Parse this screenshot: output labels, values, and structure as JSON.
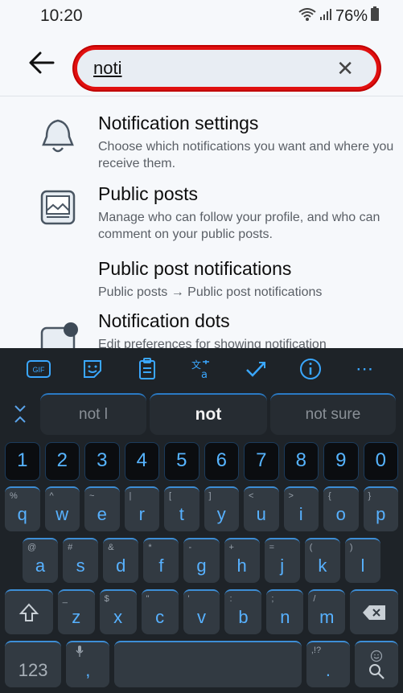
{
  "status_bar": {
    "time": "10:20",
    "battery": "76%"
  },
  "search": {
    "value": "noti",
    "clear_icon": "close-icon"
  },
  "results": [
    {
      "title": "Notification settings",
      "desc": "Choose which notifications you want and where you receive them.",
      "icon": "bell-icon"
    },
    {
      "title": "Public posts",
      "desc": "Manage who can follow your profile, and who can comment on your public posts.",
      "icon": "image-icon"
    },
    {
      "title": "Public post notifications",
      "desc": "Public posts → Public post notifications",
      "icon": ""
    },
    {
      "title": "Notification dots",
      "desc": "Edit preferences for showing notification",
      "icon": "notification-dot-icon"
    }
  ],
  "keyboard": {
    "toolbar": [
      "GIF",
      "sticker",
      "clipboard",
      "translate",
      "spellcheck",
      "info",
      "more"
    ],
    "suggestions": [
      "not l",
      "not",
      "not sure"
    ],
    "numbers": [
      "1",
      "2",
      "3",
      "4",
      "5",
      "6",
      "7",
      "8",
      "9",
      "0"
    ],
    "row1": [
      {
        "m": "q",
        "h": "%"
      },
      {
        "m": "w",
        "h": "^"
      },
      {
        "m": "e",
        "h": "~"
      },
      {
        "m": "r",
        "h": "|"
      },
      {
        "m": "t",
        "h": "["
      },
      {
        "m": "y",
        "h": "]"
      },
      {
        "m": "u",
        "h": "<"
      },
      {
        "m": "i",
        "h": ">"
      },
      {
        "m": "o",
        "h": "{"
      },
      {
        "m": "p",
        "h": "}"
      }
    ],
    "row2": [
      {
        "m": "a",
        "h": "@"
      },
      {
        "m": "s",
        "h": "#"
      },
      {
        "m": "d",
        "h": "&"
      },
      {
        "m": "f",
        "h": "*"
      },
      {
        "m": "g",
        "h": "-"
      },
      {
        "m": "h",
        "h": "+"
      },
      {
        "m": "j",
        "h": "="
      },
      {
        "m": "k",
        "h": "("
      },
      {
        "m": "l",
        "h": ")"
      }
    ],
    "row3": [
      {
        "m": "z",
        "h": "_"
      },
      {
        "m": "x",
        "h": "$"
      },
      {
        "m": "c",
        "h": "\""
      },
      {
        "m": "v",
        "h": "'"
      },
      {
        "m": "b",
        "h": ":"
      },
      {
        "m": "n",
        "h": ";"
      },
      {
        "m": "m",
        "h": "/"
      }
    ],
    "bottom": {
      "k123": "123",
      "comma": ",",
      "period": ".",
      "punct_hint": ",!?"
    }
  }
}
